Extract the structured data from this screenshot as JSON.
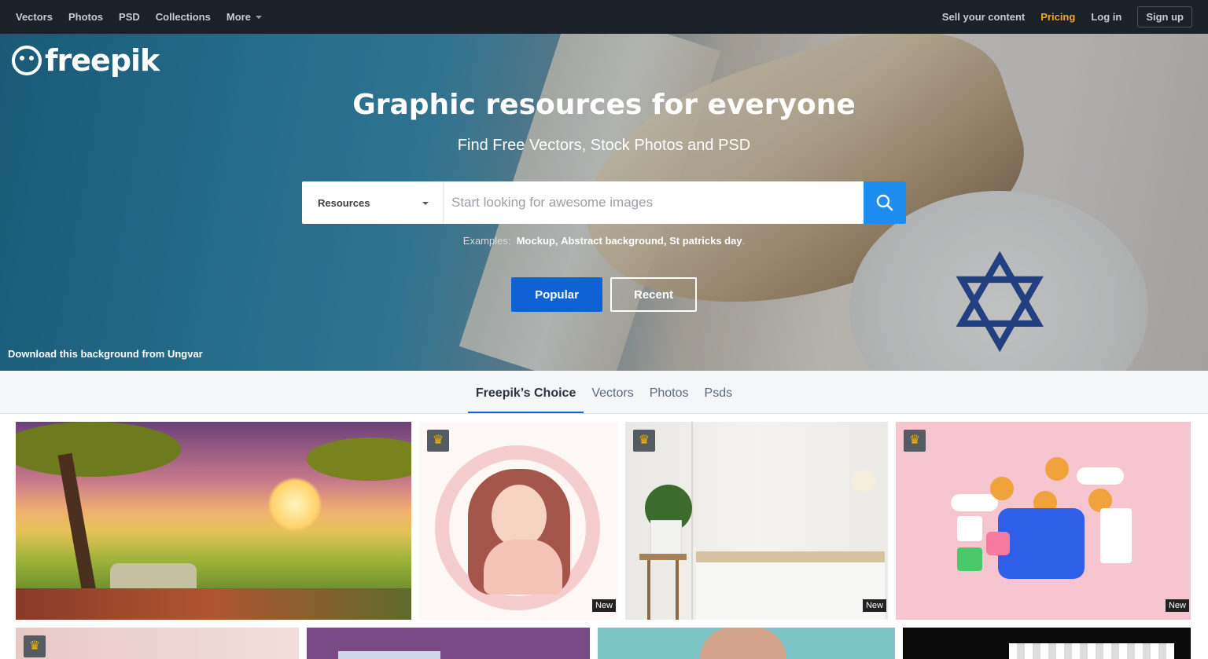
{
  "nav": {
    "left": [
      "Vectors",
      "Photos",
      "PSD",
      "Collections"
    ],
    "more": "More",
    "sell": "Sell your content",
    "pricing": "Pricing",
    "login": "Log in",
    "signup": "Sign up"
  },
  "brand": {
    "name": "freepik",
    "accent": "#0f62d4",
    "search_color": "#1e8df0",
    "pricing_color": "#f5a623"
  },
  "hero": {
    "title": "Graphic resources for everyone",
    "subtitle": "Find Free Vectors, Stock Photos and PSD",
    "search": {
      "select_value": "Resources",
      "placeholder": "Start looking for awesome images"
    },
    "examples_label": "Examples:",
    "examples": [
      "Mockup",
      "Abstract background",
      "St patricks day"
    ],
    "buttons": {
      "popular": "Popular",
      "recent": "Recent"
    },
    "credit": "Download this background from Ungvar"
  },
  "tabs": [
    {
      "label": "Freepik’s Choice",
      "active": true
    },
    {
      "label": "Vectors",
      "active": false
    },
    {
      "label": "Photos",
      "active": false
    },
    {
      "label": "Psds",
      "active": false
    }
  ],
  "grid": {
    "new_label": "New"
  }
}
